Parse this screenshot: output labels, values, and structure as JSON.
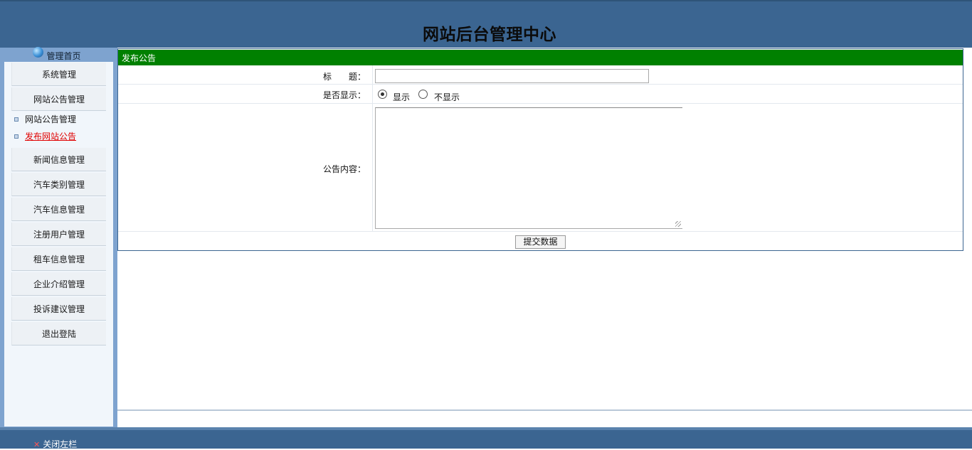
{
  "header": {
    "title": "网站后台管理中心"
  },
  "sidebar": {
    "home_label": "管理首页",
    "menu": [
      {
        "label": "系统管理"
      },
      {
        "label": "网站公告管理"
      }
    ],
    "submenu": [
      {
        "label": "网站公告管理",
        "active": false
      },
      {
        "label": "发布网站公告",
        "active": true
      }
    ],
    "menu_rest": [
      {
        "label": "新闻信息管理"
      },
      {
        "label": "汽车类别管理"
      },
      {
        "label": "汽车信息管理"
      },
      {
        "label": "注册用户管理"
      },
      {
        "label": "租车信息管理"
      },
      {
        "label": "企业介绍管理"
      },
      {
        "label": "投诉建议管理"
      },
      {
        "label": "退出登陆"
      }
    ]
  },
  "form": {
    "heading": "发布公告",
    "title_label": "标　　题：",
    "title_value": "",
    "display_label": "是否显示：",
    "display_options": [
      "显示",
      "不显示"
    ],
    "display_selected": "显示",
    "content_label": "公告内容：",
    "content_value": "",
    "submit_label": "提交数据"
  },
  "footer": {
    "close_label": "关闭左栏"
  },
  "colors": {
    "header_bg": "#3b6591",
    "panel_head": "#008000",
    "active_link": "#e00000"
  }
}
